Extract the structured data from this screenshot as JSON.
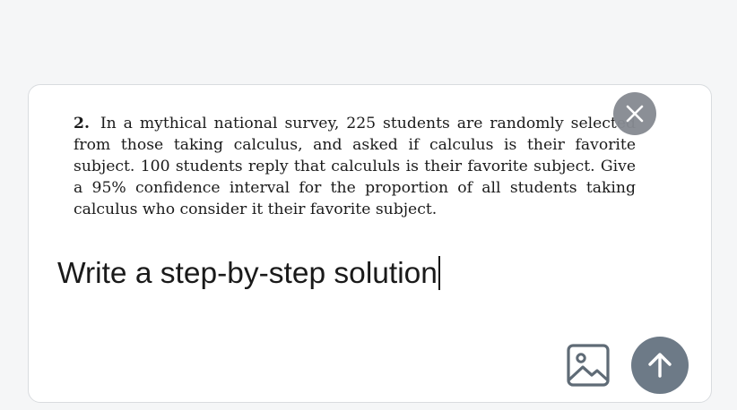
{
  "attached_image": {
    "problem_number": "2.",
    "problem_text": "In a mythical national survey, 225 students are randomly selected from those taking calculus, and asked if calculus is their favorite subject. 100 students reply that calcululs is their favorite subject. Give a 95% confidence interval for the proportion of all students taking calculus who consider it their favorite subject."
  },
  "composer": {
    "input_value": "Write a step-by-step solution"
  },
  "icons": {
    "remove": "close-icon",
    "upload": "image-icon",
    "send": "arrow-up-icon"
  },
  "colors": {
    "remove_button": "#878b92",
    "send_button": "#6d7a87",
    "upload_icon": "#5f6b76"
  }
}
